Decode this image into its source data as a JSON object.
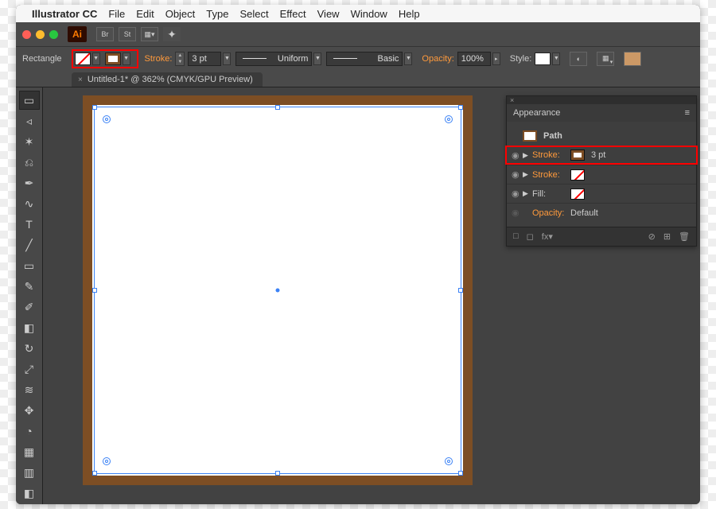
{
  "menubar": {
    "app_title": "Illustrator CC",
    "items": [
      "File",
      "Edit",
      "Object",
      "Type",
      "Select",
      "Effect",
      "View",
      "Window",
      "Help"
    ]
  },
  "appbar": {
    "logo": "Ai",
    "btn1": "Br",
    "btn2": "St"
  },
  "controlbar": {
    "tool_name": "Rectangle",
    "stroke_label": "Stroke:",
    "stroke_value": "3 pt",
    "profile_label": "Uniform",
    "brush_label": "Basic",
    "opacity_label": "Opacity:",
    "opacity_value": "100%",
    "style_label": "Style:"
  },
  "tab": {
    "title": "Untitled-1* @ 362% (CMYK/GPU Preview)",
    "close": "×"
  },
  "panel": {
    "title": "Appearance",
    "menu_glyph": "≡",
    "close_glyph": "×",
    "path_label": "Path",
    "rows": [
      {
        "label": "Stroke:",
        "value": "3 pt",
        "swatch": "stroke"
      },
      {
        "label": "Stroke:",
        "value": "",
        "swatch": "none"
      },
      {
        "label": "Fill:",
        "value": "",
        "swatch": "none"
      }
    ],
    "opacity_label": "Opacity:",
    "opacity_value": "Default",
    "footer": {
      "fx": "fx▾",
      "new_fill": "□",
      "new_stroke": "◻",
      "clear": "⊘",
      "dup": "⊞",
      "trash": "🗑"
    }
  },
  "colors": {
    "stroke_brown": "#7d4e24",
    "highlight": "#ff0000",
    "accent": "#ff9a3c"
  }
}
